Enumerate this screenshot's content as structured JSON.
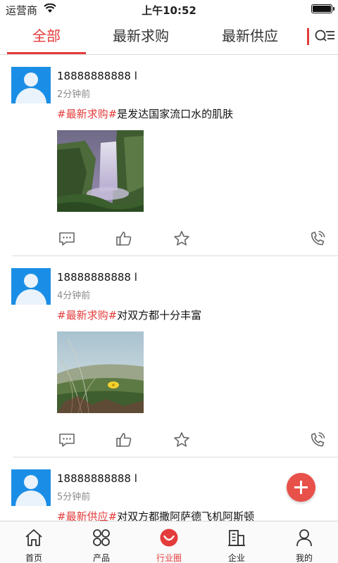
{
  "status_bar": {
    "carrier": "运营商",
    "time": "上午10:52"
  },
  "tabs": [
    {
      "label": "全部",
      "active": true
    },
    {
      "label": "最新求购",
      "active": false
    },
    {
      "label": "最新供应",
      "active": false
    }
  ],
  "posts": [
    {
      "user": "18888888888 l",
      "time": "2分钟前",
      "tag": "#最新求购#",
      "text": "是发达国家流口水的肌肤",
      "photo": "waterfall"
    },
    {
      "user": "18888888888 l",
      "time": "4分钟前",
      "tag": "#最新求购#",
      "text": "对双方都十分丰富",
      "photo": "flower-field"
    },
    {
      "user": "18888888888 l",
      "time": "5分钟前",
      "tag": "#最新供应#",
      "text": "对双方都撒阿萨德飞机阿斯顿",
      "photo": ""
    }
  ],
  "bottom_nav": [
    {
      "label": "首页",
      "icon": "home-icon"
    },
    {
      "label": "产品",
      "icon": "grid-icon"
    },
    {
      "label": "行业圈",
      "icon": "smile-icon",
      "active": true
    },
    {
      "label": "企业",
      "icon": "building-icon"
    },
    {
      "label": "我的",
      "icon": "person-icon"
    }
  ],
  "colors": {
    "accent": "#e43b3b",
    "avatar": "#1a8ee6",
    "fab": "#e8504a"
  }
}
